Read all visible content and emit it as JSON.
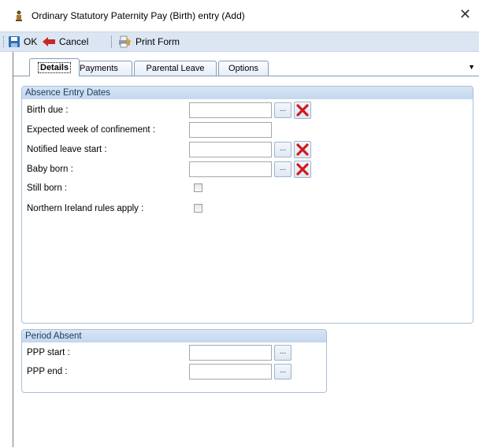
{
  "window": {
    "title": "Ordinary Statutory Paternity Pay (Birth) entry (Add)",
    "close_glyph": "✕"
  },
  "toolbar": {
    "ok_label": "OK",
    "cancel_label": "Cancel",
    "print_label": "Print Form"
  },
  "tabs": [
    {
      "label": "Details",
      "active": true
    },
    {
      "label": "Payments"
    },
    {
      "label": "Parental Leave"
    },
    {
      "label": "Options"
    }
  ],
  "tab_menu_glyph": "▼",
  "absence": {
    "header": "Absence Entry Dates",
    "birth_due": {
      "label": "Birth due :",
      "value": ""
    },
    "expected_week": {
      "label": "Expected week of confinement :",
      "value": ""
    },
    "notified_start": {
      "label": "Notified leave start :",
      "value": ""
    },
    "baby_born": {
      "label": "Baby born :",
      "value": ""
    },
    "still_born": {
      "label": "Still born :",
      "checked": false
    },
    "ni_rules": {
      "label": "Northern Ireland rules apply :",
      "checked": false
    }
  },
  "period": {
    "header": "Period Absent",
    "ppp_start": {
      "label": "PPP start :",
      "value": ""
    },
    "ppp_end": {
      "label": "PPP end :",
      "value": ""
    }
  },
  "ellipsis_label": "...",
  "colors": {
    "accent": "#1e395b",
    "group_header": "#c9dcf1",
    "delete_red": "#d11a1a"
  }
}
